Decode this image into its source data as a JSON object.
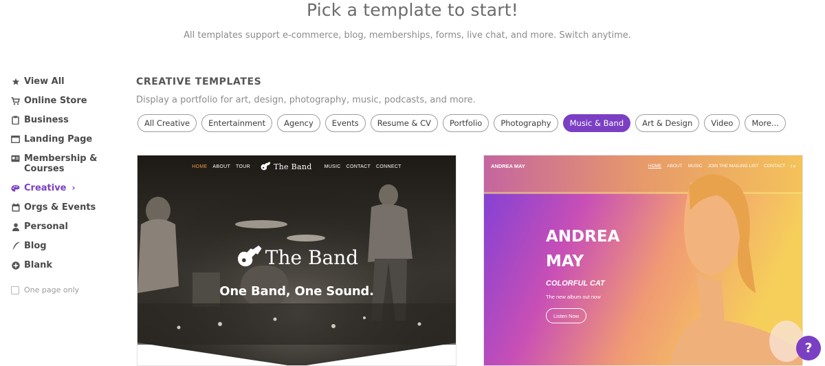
{
  "header": {
    "title": "Pick a template to start!",
    "subtitle": "All templates support e-commerce, blog, memberships, forms, live chat, and more. Switch anytime."
  },
  "sidebar": {
    "items": [
      {
        "label": "View All",
        "icon": "star-icon"
      },
      {
        "label": "Online Store",
        "icon": "cart-icon"
      },
      {
        "label": "Business",
        "icon": "clipboard-icon"
      },
      {
        "label": "Landing Page",
        "icon": "window-icon"
      },
      {
        "label": "Membership & Courses",
        "icon": "id-card-icon"
      },
      {
        "label": "Creative",
        "icon": "palette-icon",
        "active": true
      },
      {
        "label": "Orgs & Events",
        "icon": "calendar-icon"
      },
      {
        "label": "Personal",
        "icon": "person-icon"
      },
      {
        "label": "Blog",
        "icon": "pen-icon"
      },
      {
        "label": "Blank",
        "icon": "plus-circle-icon"
      }
    ],
    "one_page_label": "One page only"
  },
  "main": {
    "section_title": "CREATIVE TEMPLATES",
    "section_desc": "Display a portfolio for art, design, photography, music, podcasts, and more.",
    "filters": [
      {
        "label": "All Creative"
      },
      {
        "label": "Entertainment"
      },
      {
        "label": "Agency"
      },
      {
        "label": "Events"
      },
      {
        "label": "Resume & CV"
      },
      {
        "label": "Portfolio"
      },
      {
        "label": "Photography"
      },
      {
        "label": "Music & Band",
        "active": true
      },
      {
        "label": "Art & Design"
      },
      {
        "label": "Video"
      },
      {
        "label": "More..."
      }
    ]
  },
  "templates": {
    "band": {
      "nav": [
        "HOME",
        "ABOUT",
        "TOUR",
        "MUSIC",
        "CONTACT",
        "CONNECT"
      ],
      "logo": "The Band",
      "title": "The Band",
      "tagline": "One Band, One Sound."
    },
    "andrea": {
      "brand": "ANDREA MAY",
      "nav": [
        "HOME",
        "ABOUT",
        "MUSIC",
        "JOIN THE MAILING LIST",
        "CONTACT",
        "f ▾"
      ],
      "name_line1": "ANDREA",
      "name_line2": "MAY",
      "album_title": "COLORFUL CAT",
      "album_sub": "The new album out now",
      "button": "Listen Now"
    }
  },
  "help_label": "?",
  "colors": {
    "accent": "#7b3fc4",
    "band_home": "#f29b3b"
  }
}
